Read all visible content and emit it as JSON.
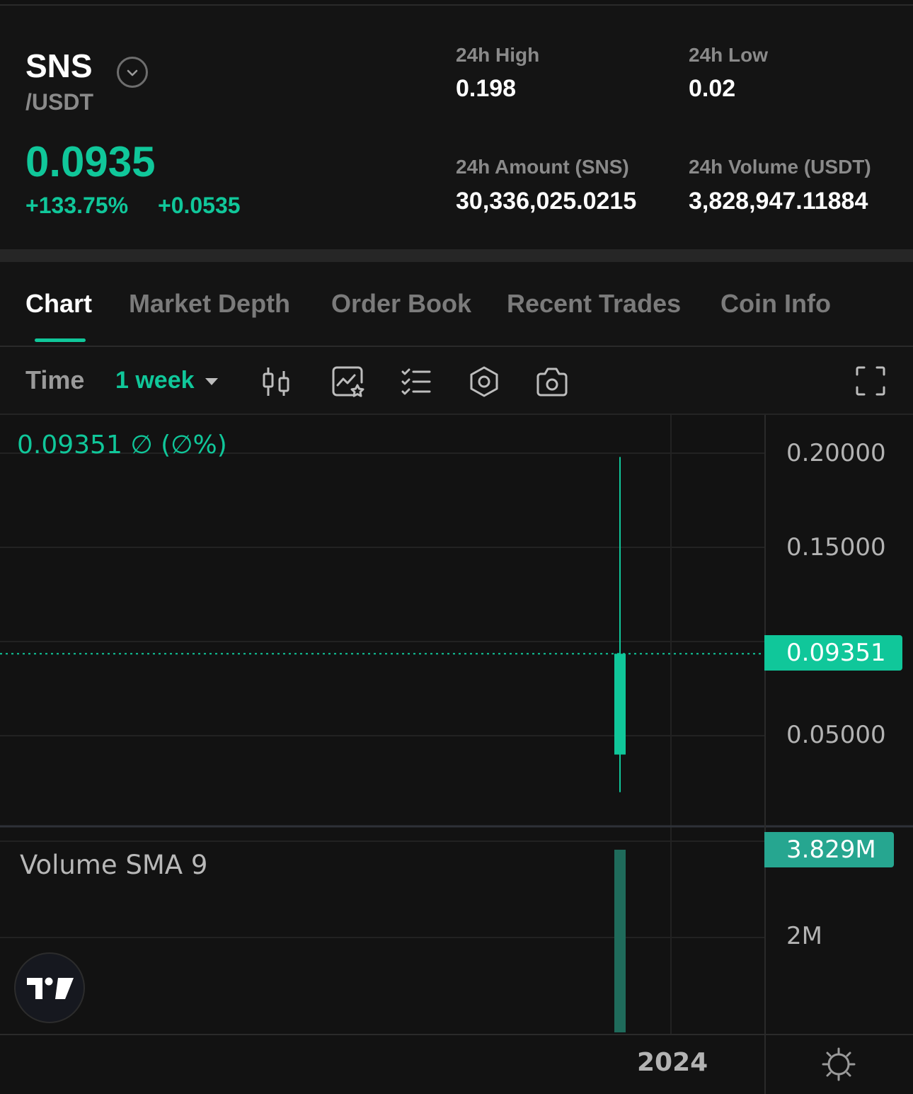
{
  "pair": {
    "base": "SNS",
    "quote": "/USDT",
    "price": "0.0935",
    "change_pct": "+133.75%",
    "change_abs": "+0.0535"
  },
  "stats": {
    "high_label": "24h High",
    "high_value": "0.198",
    "low_label": "24h Low",
    "low_value": "0.02",
    "amount_label": "24h Amount (SNS)",
    "amount_value": "30,336,025.0215",
    "volume_label": "24h Volume (USDT)",
    "volume_value": "3,828,947.11884"
  },
  "tabs": [
    "Chart",
    "Market Depth",
    "Order Book",
    "Recent Trades",
    "Coin Info"
  ],
  "active_tab": "Chart",
  "toolbar": {
    "time_label": "Time",
    "interval": "1 week",
    "icons": [
      "candlestick-icon",
      "indicator-icon",
      "checklist-icon",
      "settings-icon",
      "camera-icon",
      "fullscreen-icon"
    ]
  },
  "chart_data": {
    "type": "candlestick",
    "legend_text": "0.09351  ∅  (∅%)",
    "price_axis_labels": [
      "0.20000",
      "0.15000",
      "0.05000"
    ],
    "price_ticks": [
      0.2,
      0.15,
      0.1,
      0.05
    ],
    "last_price_label": "0.09351",
    "last_price": 0.09351,
    "candles": [
      {
        "open": 0.04,
        "high": 0.198,
        "low": 0.02,
        "close": 0.09351
      }
    ],
    "volume_indicator": "Volume SMA 9",
    "volume_last_label": "3.829M",
    "volume_last": 3828947,
    "volume_axis_label": "2M",
    "volume_ticks": [
      2000000
    ],
    "time_axis_label": "2024",
    "colors": {
      "up": "#10c79a",
      "volume": "#1f6b5b",
      "grid": "#222222"
    }
  }
}
